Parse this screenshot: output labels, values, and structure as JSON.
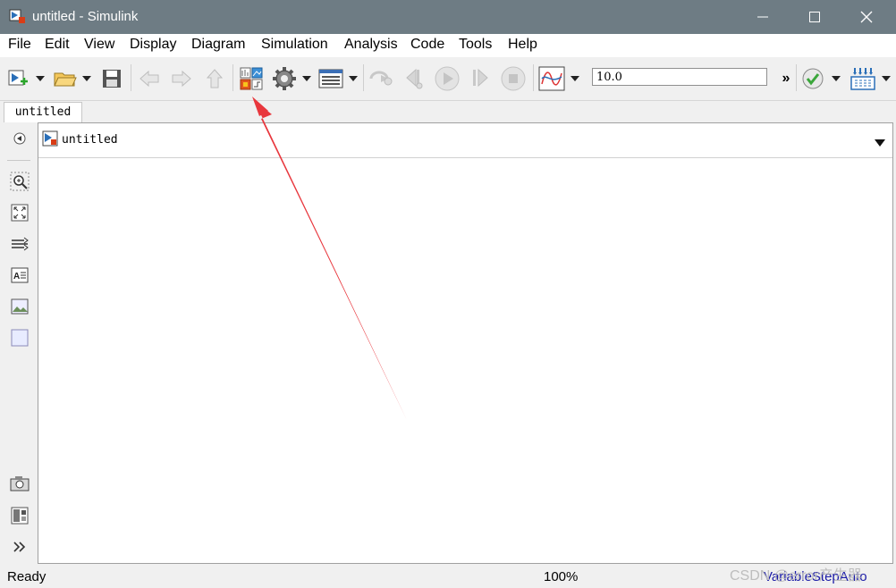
{
  "window": {
    "title": "untitled - Simulink"
  },
  "menu": [
    {
      "label": "File"
    },
    {
      "label": "Edit"
    },
    {
      "label": "View"
    },
    {
      "label": "Display"
    },
    {
      "label": "Diagram"
    },
    {
      "label": "Simulation"
    },
    {
      "label": "Analysis"
    },
    {
      "label": "Code"
    },
    {
      "label": "Tools"
    },
    {
      "label": "Help"
    }
  ],
  "toolbar": {
    "stop_time": "10.0",
    "overflow": "»",
    "icons": [
      "new-model-icon",
      "open-icon",
      "save-icon",
      "back-icon",
      "forward-icon",
      "up-icon",
      "library-browser-icon",
      "model-config-icon",
      "model-explorer-icon",
      "step-back-icon",
      "step-back-icon",
      "run-icon",
      "step-forward-icon",
      "stop-icon",
      "scope-icon",
      "check-icon",
      "build-icon"
    ]
  },
  "tab": {
    "label": "untitled"
  },
  "breadcrumb": {
    "label": "untitled"
  },
  "status": {
    "ready": "Ready",
    "zoom": "100%",
    "solver": "VariableStepAuto"
  },
  "watermark": "CSDN @error产生器",
  "colors": {
    "titlebar": "#6e7c84",
    "annotation_arrow": "#e8373d",
    "solver_text": "#1a1aa6"
  }
}
